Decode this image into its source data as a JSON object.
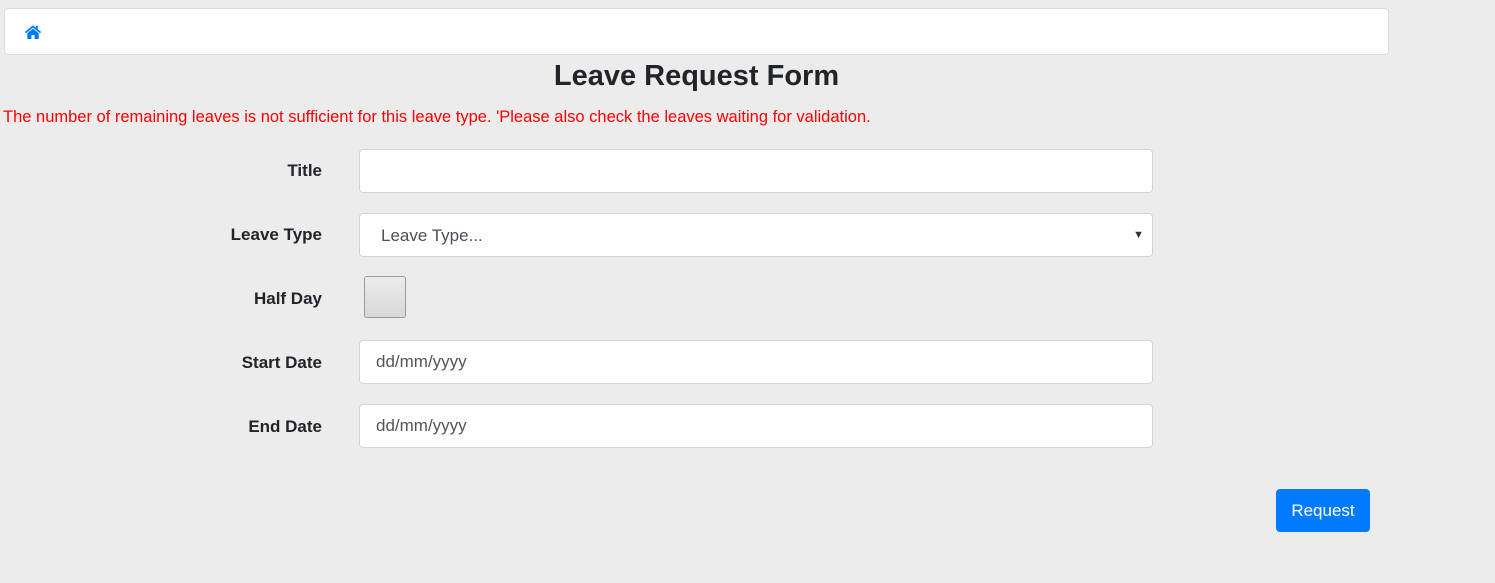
{
  "breadcrumb": {
    "home_icon": "home-icon",
    "icon_color": "#007bff"
  },
  "page_title": "Leave Request Form",
  "error_message": "The number of remaining leaves is not sufficient for this leave type. 'Please also check the leaves waiting for validation.",
  "form": {
    "title": {
      "label": "Title",
      "value": "",
      "placeholder": ""
    },
    "leave_type": {
      "label": "Leave Type",
      "selected": "Leave Type..."
    },
    "half_day": {
      "label": "Half Day",
      "checked": false
    },
    "start_date": {
      "label": "Start Date",
      "placeholder": "dd/mm/yyyy"
    },
    "end_date": {
      "label": "End Date",
      "placeholder": "dd/mm/yyyy"
    }
  },
  "submit_label": "Request",
  "colors": {
    "accent": "#007bff",
    "error": "#ff0000",
    "background": "#ececec"
  }
}
